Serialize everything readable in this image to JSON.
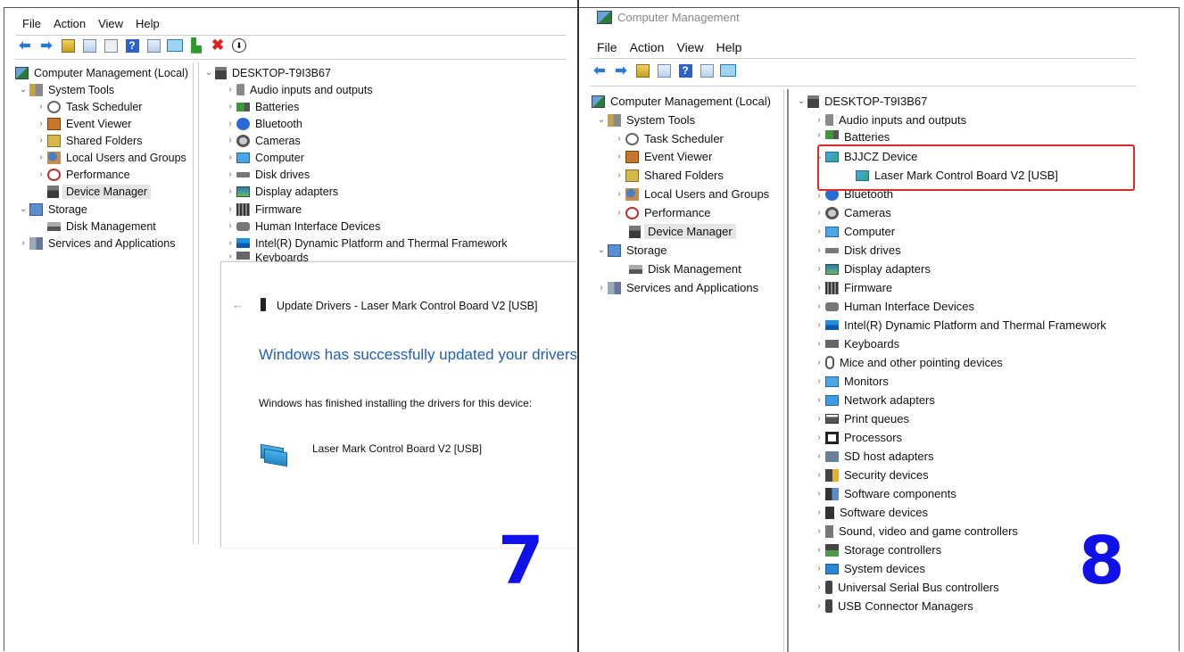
{
  "panel7": {
    "menu": [
      "File",
      "Action",
      "View",
      "Help"
    ],
    "tree": {
      "root": "Computer Management (Local)",
      "system_tools": "System Tools",
      "task_scheduler": "Task Scheduler",
      "event_viewer": "Event Viewer",
      "shared_folders": "Shared Folders",
      "local_users": "Local Users and Groups",
      "performance": "Performance",
      "device_manager": "Device Manager",
      "storage": "Storage",
      "disk_management": "Disk Management",
      "services": "Services and Applications"
    },
    "devices": {
      "host": "DESKTOP-T9I3B67",
      "items": [
        "Audio inputs and outputs",
        "Batteries",
        "Bluetooth",
        "Cameras",
        "Computer",
        "Disk drives",
        "Display adapters",
        "Firmware",
        "Human Interface Devices",
        "Intel(R) Dynamic Platform and Thermal Framework",
        "Keyboards"
      ]
    },
    "dialog": {
      "back": "←",
      "title": "Update Drivers - Laser Mark Control Board V2 [USB]",
      "heading": "Windows has successfully updated your drivers",
      "text": "Windows has finished installing the drivers for this device:",
      "device": "Laser Mark Control Board V2 [USB]"
    },
    "step_number": "7"
  },
  "panel8": {
    "window_title": "Computer Management",
    "menu": [
      "File",
      "Action",
      "View",
      "Help"
    ],
    "tree": {
      "root": "Computer Management (Local)",
      "system_tools": "System Tools",
      "task_scheduler": "Task Scheduler",
      "event_viewer": "Event Viewer",
      "shared_folders": "Shared Folders",
      "local_users": "Local Users and Groups",
      "performance": "Performance",
      "device_manager": "Device Manager",
      "storage": "Storage",
      "disk_management": "Disk Management",
      "services": "Services and Applications"
    },
    "devices": {
      "host": "DESKTOP-T9I3B67",
      "audio": "Audio inputs and outputs",
      "batteries": "Batteries",
      "bjjcz": "BJJCZ Device",
      "bjjcz_child": "Laser Mark Control Board V2 [USB]",
      "items": [
        "Bluetooth",
        "Cameras",
        "Computer",
        "Disk drives",
        "Display adapters",
        "Firmware",
        "Human Interface Devices",
        "Intel(R) Dynamic Platform and Thermal Framework",
        "Keyboards",
        "Mice and other pointing devices",
        "Monitors",
        "Network adapters",
        "Print queues",
        "Processors",
        "SD host adapters",
        "Security devices",
        "Software components",
        "Software devices",
        "Sound, video and game controllers",
        "Storage controllers",
        "System devices",
        "Universal Serial Bus controllers",
        "USB Connector Managers"
      ]
    },
    "step_number": "8",
    "highlight_color": "#e02a2a"
  }
}
